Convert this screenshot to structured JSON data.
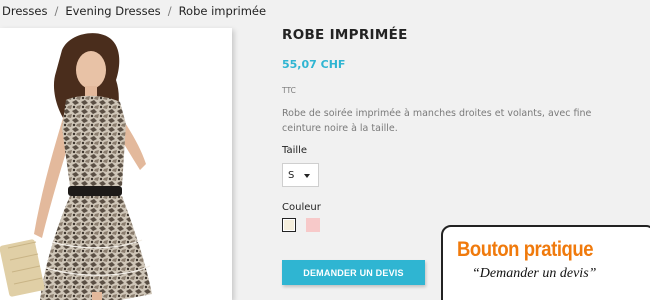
{
  "breadcrumb": {
    "items": [
      "Dresses",
      "Evening Dresses",
      "Robe imprimée"
    ],
    "separator": "/"
  },
  "product": {
    "title": "ROBE IMPRIMÉE",
    "price": "55,07 CHF",
    "tax_label": "TTC",
    "description": "Robe de soirée imprimée à manches droites et volants, avec fine ceinture noire à la taille.",
    "image_alt": "model wearing printed dress",
    "size": {
      "label": "Taille",
      "selected": "S"
    },
    "color": {
      "label": "Couleur",
      "swatches": [
        "#f5eedb",
        "#f7c9c9"
      ],
      "selected_index": 0
    },
    "cta_label": "DEMANDER UN DEVIS"
  },
  "callout": {
    "title": "Bouton pratique",
    "subtitle": "“Demander un devis”"
  },
  "colors": {
    "accent": "#2fb5d2",
    "callout_title": "#f07a0c",
    "background": "#f1f1f1"
  }
}
